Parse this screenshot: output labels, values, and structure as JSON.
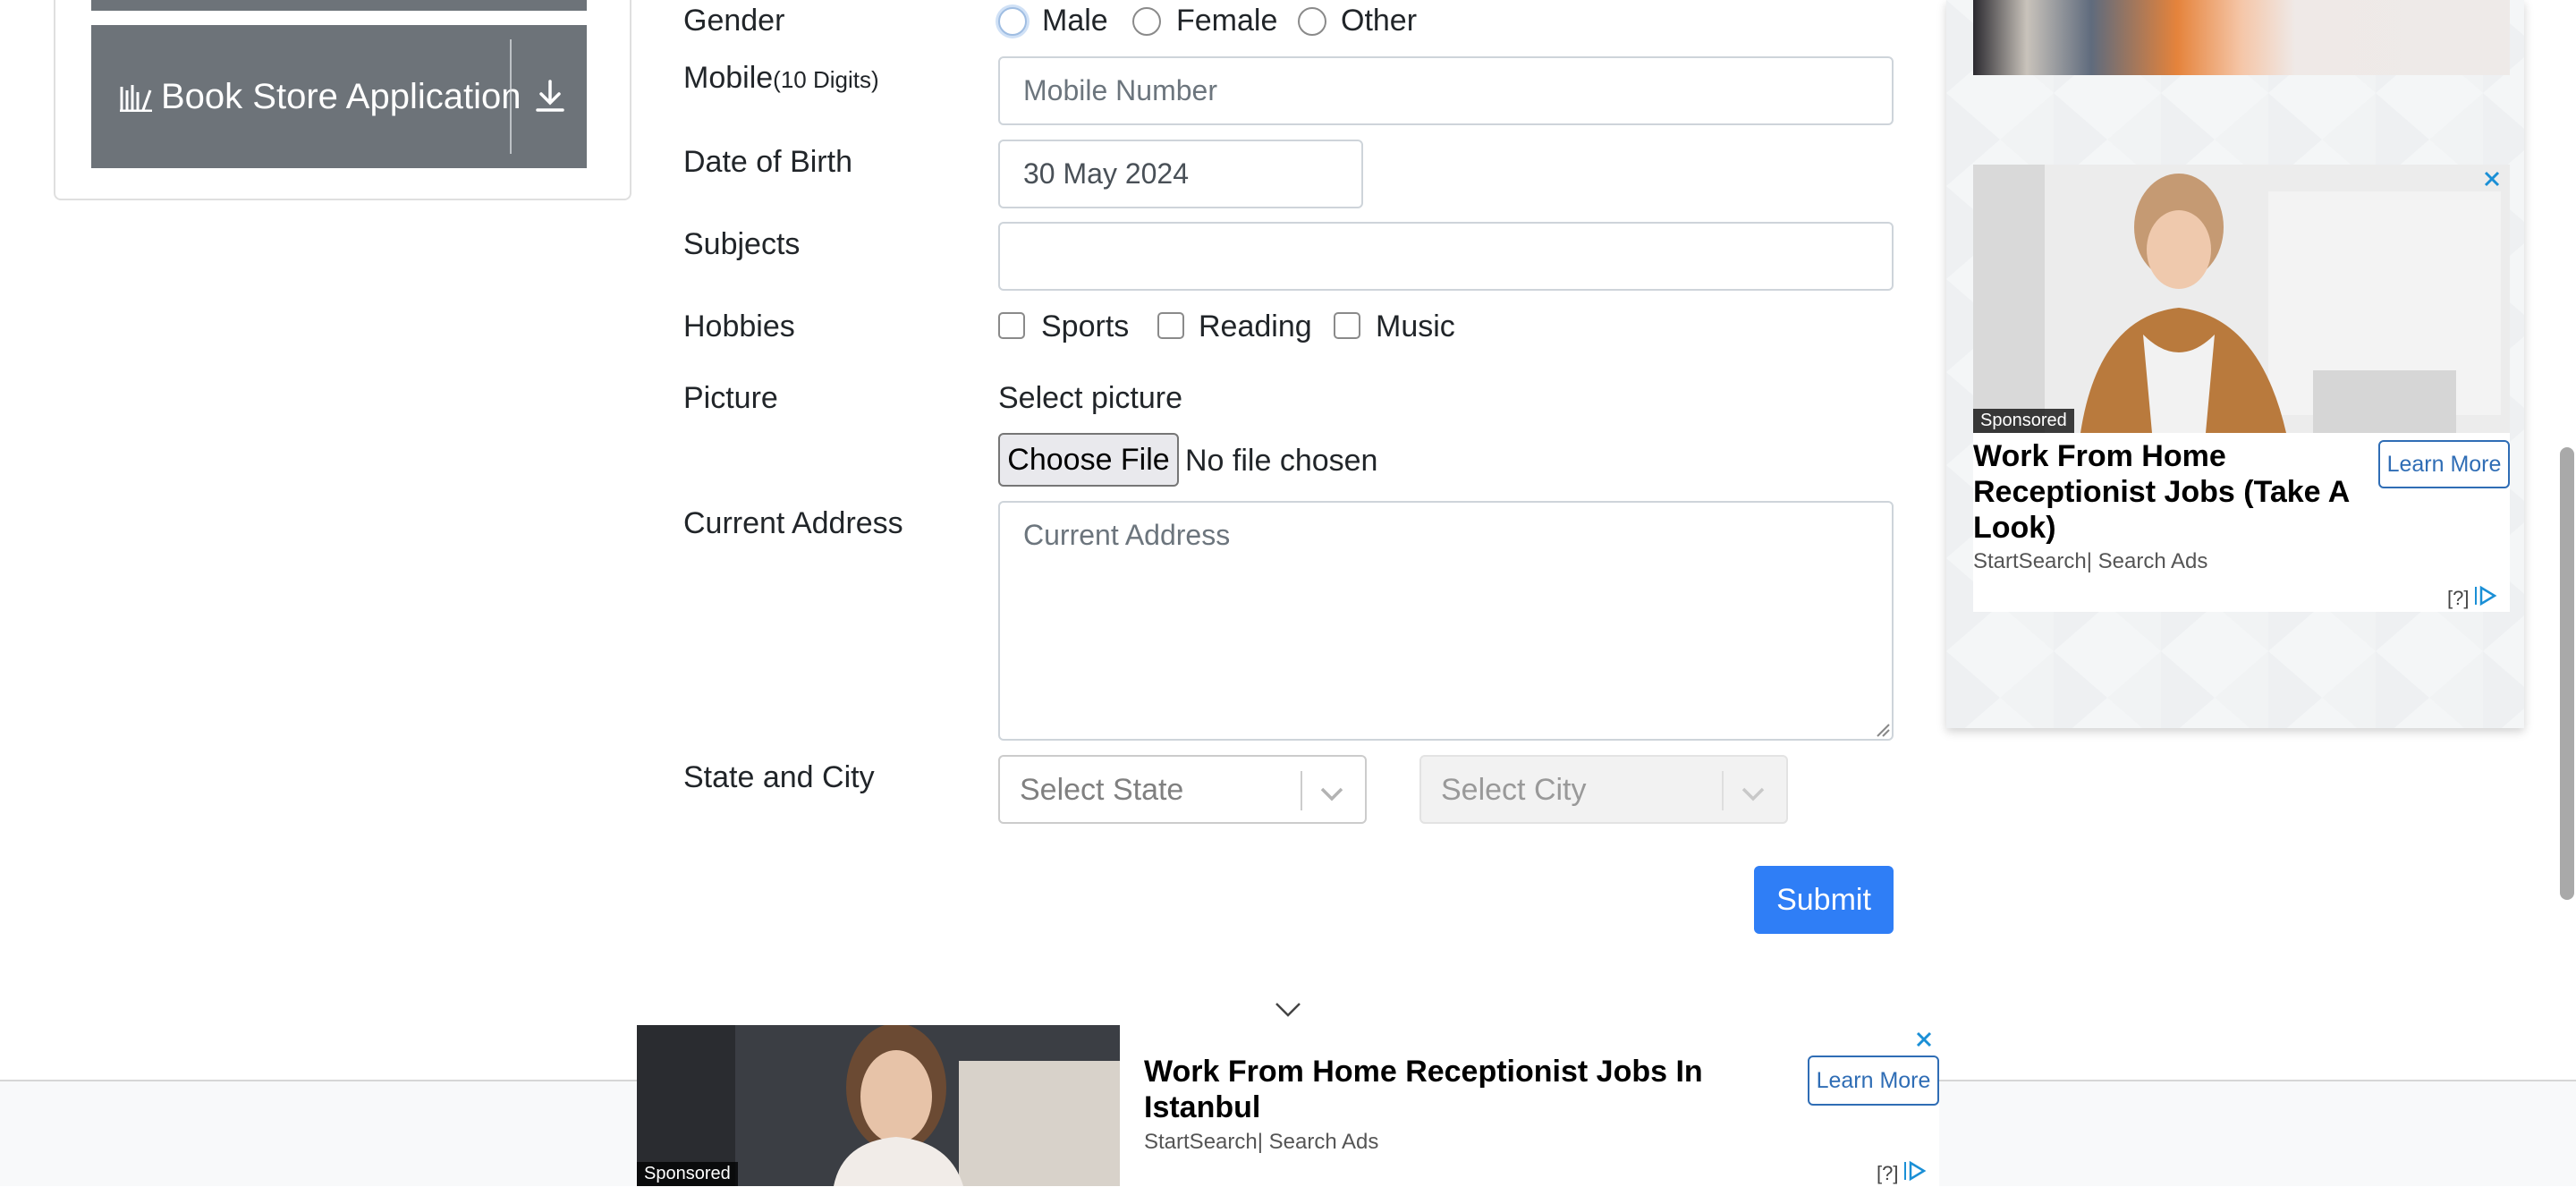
{
  "sidebar": {
    "book_store": "Book Store Application"
  },
  "form": {
    "gender_label": "Gender",
    "gender_options": [
      "Male",
      "Female",
      "Other"
    ],
    "mobile_label": "Mobile",
    "mobile_hint": "(10 Digits)",
    "mobile_placeholder": "Mobile Number",
    "dob_label": "Date of Birth",
    "dob_value": "30 May 2024",
    "subjects_label": "Subjects",
    "hobbies_label": "Hobbies",
    "hobbies": [
      "Sports",
      "Reading",
      "Music"
    ],
    "picture_label": "Picture",
    "select_picture": "Select picture",
    "choose_file": "Choose File",
    "no_file": "No file chosen",
    "address_label": "Current Address",
    "address_placeholder": "Current Address",
    "state_city_label": "State and City",
    "state_placeholder": "Select State",
    "city_placeholder": "Select City",
    "submit": "Submit"
  },
  "right_ad": {
    "sponsored": "Sponsored",
    "title": "Work From Home Receptionist Jobs (Take A Look)",
    "source": "StartSearch| Search Ads",
    "learn_more": "Learn More",
    "help": "[?]"
  },
  "bottom_ad": {
    "sponsored": "Sponsored",
    "title": "Work From Home Receptionist Jobs In Istanbul",
    "source": "StartSearch| Search Ads",
    "learn_more": "Learn More",
    "help": "[?]"
  },
  "colors": {
    "accent": "#2f7ef6",
    "sidebar_button": "#6d7379",
    "ad_link": "#2f6db5"
  }
}
